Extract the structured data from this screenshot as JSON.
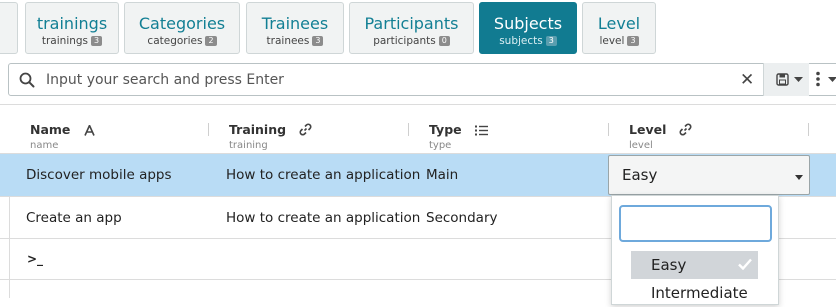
{
  "tabs": [
    {
      "label": "trainings",
      "sub": "trainings",
      "count": "3",
      "active": false
    },
    {
      "label": "Categories",
      "sub": "categories",
      "count": "2",
      "active": false
    },
    {
      "label": "Trainees",
      "sub": "trainees",
      "count": "3",
      "active": false
    },
    {
      "label": "Participants",
      "sub": "participants",
      "count": "0",
      "active": false
    },
    {
      "label": "Subjects",
      "sub": "subjects",
      "count": "3",
      "active": true
    },
    {
      "label": "Level",
      "sub": "level",
      "count": "3",
      "active": false
    }
  ],
  "search": {
    "placeholder": "Input your search and press Enter",
    "value": "",
    "clear_glyph": "✕"
  },
  "columns": [
    {
      "name": "Name",
      "sub": "name",
      "icon": "sort-alpha-icon"
    },
    {
      "name": "Training",
      "sub": "training",
      "icon": "link-icon"
    },
    {
      "name": "Type",
      "sub": "type",
      "icon": "list-icon"
    },
    {
      "name": "Level",
      "sub": "level",
      "icon": "link-icon"
    }
  ],
  "rows": [
    {
      "name": "Discover mobile apps",
      "training": "How to create an application",
      "type": "Main",
      "level": "Easy"
    },
    {
      "name": "Create an app",
      "training": "How to create an application",
      "type": "Secondary",
      "level": ""
    }
  ],
  "new_row_prompt": ">_",
  "level_editor": {
    "value": "Easy",
    "filter_value": "",
    "options": [
      {
        "label": "Easy",
        "selected": true
      },
      {
        "label": "Intermediate",
        "selected": false
      }
    ]
  },
  "colors": {
    "accent": "#117b91",
    "tab_text": "#127f94",
    "selected_row": "#b9dcf5",
    "focus_ring": "#6ea9dc"
  }
}
